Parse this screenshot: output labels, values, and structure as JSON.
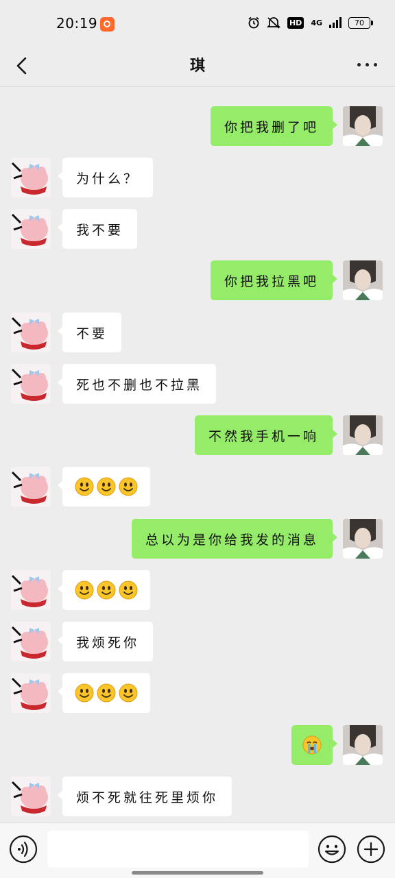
{
  "status": {
    "time": "20:19",
    "network": "4G",
    "hd": "HD",
    "battery": "70"
  },
  "nav": {
    "title": "琪"
  },
  "messages": [
    {
      "from": "me",
      "text": "你把我删了吧"
    },
    {
      "from": "friend",
      "text": "为什么？"
    },
    {
      "from": "friend",
      "text": "我不要"
    },
    {
      "from": "me",
      "text": "你把我拉黑吧"
    },
    {
      "from": "friend",
      "text": "不要"
    },
    {
      "from": "friend",
      "text": "死也不删也不拉黑"
    },
    {
      "from": "me",
      "text": "不然我手机一响"
    },
    {
      "from": "friend",
      "emoji": [
        "smile-emoji",
        "smile-emoji",
        "smile-emoji"
      ]
    },
    {
      "from": "me",
      "text": "总以为是你给我发的消息"
    },
    {
      "from": "friend",
      "emoji": [
        "smile-emoji",
        "smile-emoji",
        "smile-emoji"
      ]
    },
    {
      "from": "friend",
      "text": "我烦死你"
    },
    {
      "from": "friend",
      "emoji": [
        "smile-emoji",
        "smile-emoji",
        "smile-emoji"
      ]
    },
    {
      "from": "me",
      "emoji": [
        "crying-emoji"
      ]
    },
    {
      "from": "friend",
      "text": "烦不死就往死里烦你"
    }
  ],
  "input": {
    "value": "",
    "placeholder": ""
  },
  "colors": {
    "background": "#ededed",
    "outgoing_bubble": "#95ec69",
    "incoming_bubble": "#ffffff",
    "status_app_icon": "#ff6a2b"
  }
}
